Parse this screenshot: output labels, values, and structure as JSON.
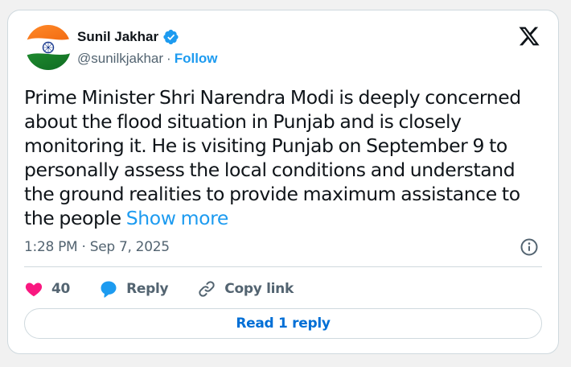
{
  "author": {
    "name": "Sunil Jakhar",
    "handle": "@sunilkjakhar",
    "separator": "·",
    "follow_label": "Follow",
    "avatar_icon": "india-flag-avatar",
    "verified_icon": "verified-badge-icon"
  },
  "tweet": {
    "text": "Prime Minister Shri Narendra Modi is deeply concerned about the flood situation in Punjab and is closely monitoring it. He is visiting Punjab on September 9 to personally assess the local conditions and understand the ground realities to provide maximum assistance to the people",
    "show_more_label": "Show more",
    "timestamp": "1:28 PM · Sep 7, 2025"
  },
  "actions": {
    "like_count": "40",
    "reply_label": "Reply",
    "copy_link_label": "Copy link"
  },
  "footer": {
    "read_reply_label": "Read 1 reply"
  },
  "colors": {
    "accent": "#1d9bf0",
    "like": "#f91880",
    "text": "#0f1419",
    "secondary_text": "#536471",
    "border": "#cfd9de"
  }
}
